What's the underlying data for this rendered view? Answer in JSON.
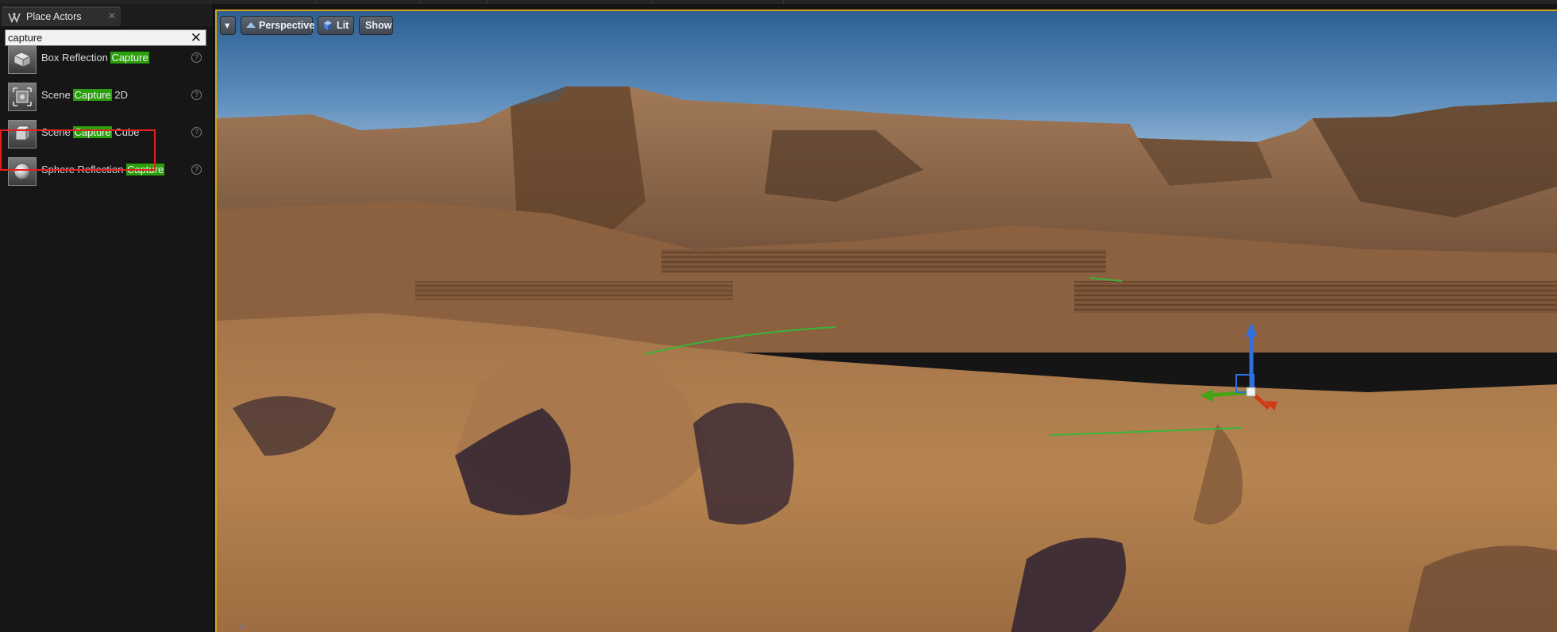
{
  "panel": {
    "tab_title": "Place Actors",
    "tab_close": "✕",
    "search": {
      "value": "capture",
      "clear_glyph": "✕"
    },
    "items": [
      {
        "pre": "Box Reflection ",
        "match": "Capture",
        "post": "",
        "icon": "box-reflection-capture-icon",
        "help": "?"
      },
      {
        "pre": "Scene ",
        "match": "Capture",
        "post": " 2D",
        "icon": "scene-capture-2d-icon",
        "help": "?"
      },
      {
        "pre": "Scene ",
        "match": "Capture",
        "post": " Cube",
        "icon": "scene-capture-cube-icon",
        "help": "?",
        "selected": true
      },
      {
        "pre": "Sphere Reflection ",
        "match": "Capture",
        "post": "",
        "icon": "sphere-reflection-capture-icon",
        "help": "?"
      }
    ]
  },
  "viewport": {
    "menu_glyph": "▾",
    "perspective_label": "Perspective",
    "lit_label": "Lit",
    "show_label": "Show"
  },
  "colors": {
    "accent_border": "#d4a417",
    "search_highlight": "#2ba00d",
    "selection_outline": "#e52020",
    "gizmo_x": "#d13a17",
    "gizmo_y": "#46a414",
    "gizmo_z": "#2f6fe0"
  }
}
